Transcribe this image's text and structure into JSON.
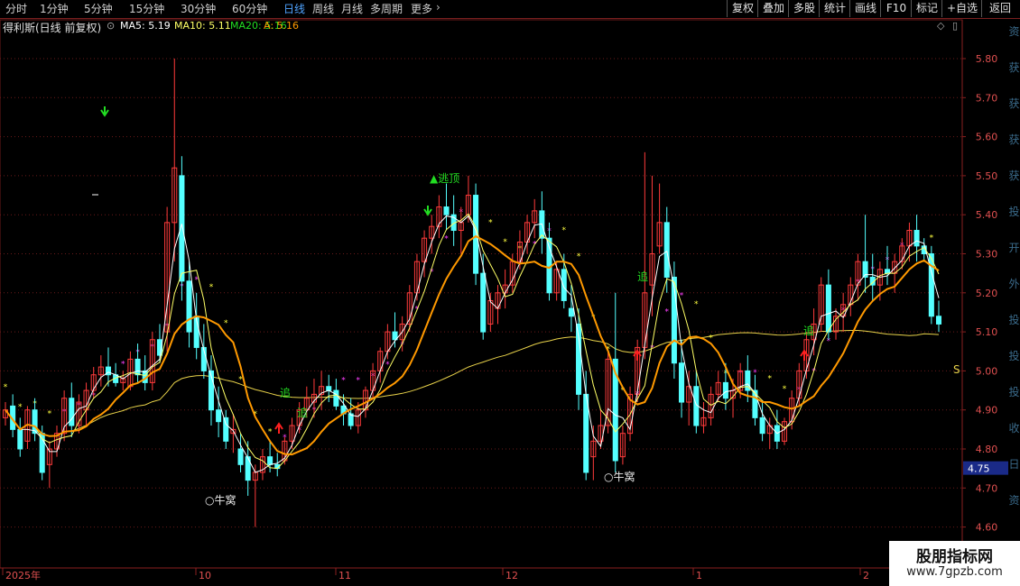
{
  "toolbar": {
    "periods": [
      "分时",
      "1分钟",
      "5分钟",
      "15分钟",
      "30分钟",
      "60分钟",
      "日线",
      "周线",
      "月线",
      "多周期",
      "更多"
    ],
    "active_period": "日线",
    "buttons": [
      "复权",
      "叠加",
      "多股",
      "统计",
      "画线",
      "F10",
      "标记",
      "+自选",
      "返回"
    ]
  },
  "infobar": {
    "stock_name": "得利斯(日线 前复权)",
    "ma5": "MA5: 5.19",
    "ma10": "MA10: 5.11",
    "ma20": "MA20: 5.16",
    "a_value": "A: 5.16"
  },
  "axis": {
    "price_ticks": [
      "5.80",
      "5.70",
      "5.60",
      "5.50",
      "5.40",
      "5.30",
      "5.20",
      "5.10",
      "5.00",
      "4.90",
      "4.80",
      "4.70",
      "4.60"
    ],
    "current_price": "4.75",
    "months": [
      "2025年",
      "10",
      "11",
      "12",
      "1",
      "2"
    ]
  },
  "annotations": {
    "top_escape": "▲逃顶",
    "bottom_1": "○牛窝",
    "bottom_2": "○牛窝",
    "chase_1": "追",
    "chase_2": "追",
    "chase_3": "追",
    "chase_4": "追",
    "s_marker": "S"
  },
  "right_strip": [
    "资",
    "获",
    "获",
    "获",
    "获",
    "投",
    "开",
    "外",
    "投",
    "投",
    "投",
    "收",
    "日",
    "资"
  ],
  "watermark": {
    "title": "股朋指标网",
    "url": "www.7gpzb.com"
  },
  "colors": {
    "up": "#ff3b3b",
    "down": "#54ffff",
    "ma_white": "#ffffff",
    "ma_yellow": "#ffff66",
    "ma_orange": "#ff9900",
    "ma_long": "#e8d24a",
    "star_magenta": "#ff40ff",
    "star_yellow": "#ffff40",
    "signal_green": "#22dd22",
    "signal_red": "#ff2020",
    "grid": "#6a1a1a"
  },
  "chart_data": {
    "type": "candlestick",
    "ylim": [
      4.6,
      5.85
    ],
    "candles": [
      [
        4.88,
        4.92,
        4.86,
        4.9
      ],
      [
        4.91,
        4.94,
        4.83,
        4.85
      ],
      [
        4.85,
        4.88,
        4.78,
        4.8
      ],
      [
        4.82,
        4.91,
        4.8,
        4.9
      ],
      [
        4.9,
        4.93,
        4.82,
        4.84
      ],
      [
        4.84,
        4.86,
        4.72,
        4.74
      ],
      [
        4.76,
        4.82,
        4.7,
        4.8
      ],
      [
        4.8,
        4.86,
        4.78,
        4.84
      ],
      [
        4.84,
        4.95,
        4.82,
        4.93
      ],
      [
        4.93,
        4.97,
        4.83,
        4.86
      ],
      [
        4.86,
        4.94,
        4.84,
        4.92
      ],
      [
        4.9,
        4.97,
        4.86,
        4.95
      ],
      [
        4.95,
        5.01,
        4.93,
        4.99
      ],
      [
        4.99,
        5.04,
        4.96,
        5.01
      ],
      [
        5.01,
        5.06,
        4.96,
        4.99
      ],
      [
        4.99,
        5.02,
        4.96,
        4.97
      ],
      [
        4.97,
        5.0,
        4.95,
        4.98
      ],
      [
        4.96,
        5.05,
        4.95,
        5.03
      ],
      [
        5.03,
        5.07,
        4.97,
        4.99
      ],
      [
        5.0,
        5.04,
        4.95,
        4.97
      ],
      [
        4.97,
        5.1,
        4.95,
        5.08
      ],
      [
        5.08,
        5.12,
        5.02,
        5.04
      ],
      [
        5.1,
        5.42,
        5.05,
        5.38
      ],
      [
        5.38,
        5.8,
        5.28,
        5.52
      ],
      [
        5.5,
        5.55,
        5.18,
        5.23
      ],
      [
        5.23,
        5.28,
        5.06,
        5.1
      ],
      [
        5.14,
        5.2,
        5.03,
        5.06
      ],
      [
        5.06,
        5.12,
        4.98,
        5.0
      ],
      [
        5.0,
        5.04,
        4.86,
        4.9
      ],
      [
        4.9,
        4.96,
        4.83,
        4.87
      ],
      [
        4.88,
        4.9,
        4.8,
        4.82
      ],
      [
        4.84,
        4.89,
        4.79,
        4.85
      ],
      [
        4.8,
        4.84,
        4.74,
        4.76
      ],
      [
        4.78,
        4.82,
        4.68,
        4.72
      ],
      [
        4.72,
        4.76,
        4.6,
        4.74
      ],
      [
        4.74,
        4.8,
        4.72,
        4.78
      ],
      [
        4.78,
        4.82,
        4.74,
        4.76
      ],
      [
        4.76,
        4.79,
        4.73,
        4.75
      ],
      [
        4.77,
        4.83,
        4.76,
        4.82
      ],
      [
        4.82,
        4.88,
        4.8,
        4.86
      ],
      [
        4.86,
        4.92,
        4.84,
        4.9
      ],
      [
        4.9,
        4.96,
        4.88,
        4.93
      ],
      [
        4.92,
        4.98,
        4.88,
        4.94
      ],
      [
        4.94,
        5.0,
        4.9,
        4.96
      ],
      [
        4.96,
        4.99,
        4.92,
        4.95
      ],
      [
        4.95,
        4.98,
        4.9,
        4.91
      ],
      [
        4.91,
        4.94,
        4.86,
        4.89
      ],
      [
        4.89,
        4.93,
        4.85,
        4.86
      ],
      [
        4.86,
        4.92,
        4.84,
        4.9
      ],
      [
        4.9,
        4.96,
        4.88,
        4.95
      ],
      [
        4.95,
        5.02,
        4.93,
        5.0
      ],
      [
        5.0,
        5.06,
        4.97,
        5.05
      ],
      [
        5.05,
        5.12,
        5.03,
        5.1
      ],
      [
        5.1,
        5.15,
        5.06,
        5.08
      ],
      [
        5.08,
        5.14,
        5.05,
        5.12
      ],
      [
        5.12,
        5.22,
        5.1,
        5.2
      ],
      [
        5.2,
        5.3,
        5.18,
        5.28
      ],
      [
        5.28,
        5.36,
        5.24,
        5.34
      ],
      [
        5.34,
        5.4,
        5.3,
        5.37
      ],
      [
        5.37,
        5.45,
        5.34,
        5.42
      ],
      [
        5.42,
        5.48,
        5.36,
        5.4
      ],
      [
        5.4,
        5.45,
        5.32,
        5.36
      ],
      [
        5.36,
        5.42,
        5.3,
        5.38
      ],
      [
        5.4,
        5.5,
        5.38,
        5.45
      ],
      [
        5.45,
        5.48,
        5.22,
        5.25
      ],
      [
        5.25,
        5.3,
        5.08,
        5.1
      ],
      [
        5.12,
        5.2,
        5.1,
        5.18
      ],
      [
        5.16,
        5.22,
        5.12,
        5.2
      ],
      [
        5.2,
        5.26,
        5.16,
        5.22
      ],
      [
        5.22,
        5.3,
        5.2,
        5.28
      ],
      [
        5.28,
        5.36,
        5.26,
        5.33
      ],
      [
        5.33,
        5.4,
        5.3,
        5.38
      ],
      [
        5.38,
        5.44,
        5.34,
        5.41
      ],
      [
        5.41,
        5.46,
        5.3,
        5.34
      ],
      [
        5.34,
        5.38,
        5.18,
        5.2
      ],
      [
        5.2,
        5.28,
        5.18,
        5.26
      ],
      [
        5.26,
        5.3,
        5.16,
        5.18
      ],
      [
        5.16,
        5.22,
        5.1,
        5.14
      ],
      [
        5.12,
        5.16,
        4.9,
        4.94
      ],
      [
        4.94,
        5.0,
        4.72,
        4.74
      ],
      [
        4.78,
        4.86,
        4.72,
        4.82
      ],
      [
        4.82,
        4.9,
        4.8,
        4.86
      ],
      [
        4.86,
        5.05,
        4.84,
        5.03
      ],
      [
        5.03,
        5.2,
        4.74,
        4.77
      ],
      [
        4.78,
        4.86,
        4.76,
        4.84
      ],
      [
        4.84,
        4.96,
        4.82,
        4.94
      ],
      [
        4.94,
        5.08,
        4.92,
        5.06
      ],
      [
        5.06,
        5.56,
        5.03,
        5.2
      ],
      [
        5.22,
        5.5,
        5.14,
        5.3
      ],
      [
        5.32,
        5.48,
        5.3,
        5.38
      ],
      [
        5.38,
        5.42,
        5.2,
        5.24
      ],
      [
        5.24,
        5.28,
        4.98,
        5.02
      ],
      [
        5.02,
        5.08,
        4.88,
        4.92
      ],
      [
        4.92,
        5.0,
        4.86,
        4.96
      ],
      [
        4.96,
        5.0,
        4.84,
        4.86
      ],
      [
        4.86,
        4.92,
        4.84,
        4.88
      ],
      [
        4.88,
        4.96,
        4.86,
        4.94
      ],
      [
        4.94,
        5.0,
        4.92,
        4.97
      ],
      [
        4.97,
        5.02,
        4.9,
        4.93
      ],
      [
        4.93,
        4.98,
        4.88,
        4.95
      ],
      [
        4.95,
        5.02,
        4.93,
        5.0
      ],
      [
        5.0,
        5.04,
        4.92,
        4.95
      ],
      [
        4.95,
        4.99,
        4.86,
        4.88
      ],
      [
        4.88,
        4.92,
        4.82,
        4.84
      ],
      [
        4.84,
        4.88,
        4.8,
        4.86
      ],
      [
        4.86,
        4.9,
        4.8,
        4.82
      ],
      [
        4.82,
        4.88,
        4.81,
        4.87
      ],
      [
        4.87,
        4.95,
        4.85,
        4.93
      ],
      [
        4.93,
        5.02,
        4.91,
        5.0
      ],
      [
        5.0,
        5.1,
        4.98,
        5.08
      ],
      [
        5.08,
        5.16,
        5.04,
        5.12
      ],
      [
        5.12,
        5.24,
        5.1,
        5.22
      ],
      [
        5.22,
        5.26,
        5.08,
        5.1
      ],
      [
        5.1,
        5.16,
        5.08,
        5.14
      ],
      [
        5.14,
        5.2,
        5.1,
        5.17
      ],
      [
        5.17,
        5.24,
        5.14,
        5.22
      ],
      [
        5.22,
        5.3,
        5.18,
        5.28
      ],
      [
        5.28,
        5.4,
        5.2,
        5.24
      ],
      [
        5.24,
        5.3,
        5.18,
        5.22
      ],
      [
        5.22,
        5.28,
        5.18,
        5.26
      ],
      [
        5.26,
        5.32,
        5.22,
        5.25
      ],
      [
        5.25,
        5.3,
        5.2,
        5.28
      ],
      [
        5.28,
        5.34,
        5.26,
        5.32
      ],
      [
        5.32,
        5.38,
        5.28,
        5.36
      ],
      [
        5.36,
        5.4,
        5.28,
        5.32
      ],
      [
        5.32,
        5.34,
        5.28,
        5.3
      ],
      [
        5.3,
        5.32,
        5.12,
        5.14
      ],
      [
        5.14,
        5.18,
        5.1,
        5.12
      ]
    ]
  }
}
